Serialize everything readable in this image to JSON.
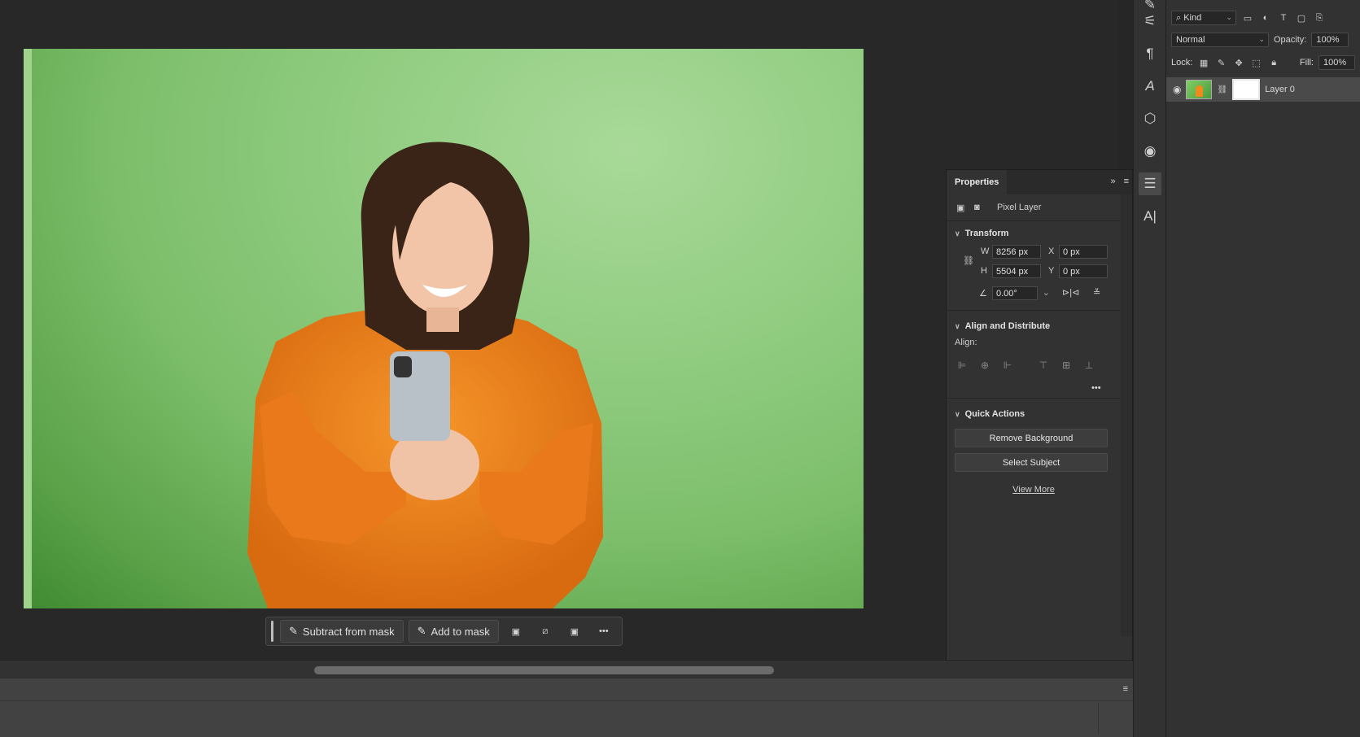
{
  "context_bar": {
    "subtract_label": "Subtract from mask",
    "add_label": "Add to mask",
    "more_label": "•••"
  },
  "layers_panel": {
    "filter_kind": "Kind",
    "blend_mode": "Normal",
    "opacity_label": "Opacity:",
    "opacity_value": "100%",
    "lock_label": "Lock:",
    "fill_label": "Fill:",
    "fill_value": "100%",
    "layer_name": "Layer 0"
  },
  "properties": {
    "tab_label": "Properties",
    "layer_type": "Pixel Layer",
    "transform": {
      "title": "Transform",
      "w_label": "W",
      "w_value": "8256 px",
      "h_label": "H",
      "h_value": "5504 px",
      "x_label": "X",
      "x_value": "0 px",
      "y_label": "Y",
      "y_value": "0 px",
      "angle_value": "0.00°"
    },
    "align": {
      "title": "Align and Distribute",
      "align_label": "Align:",
      "more_label": "•••"
    },
    "quick_actions": {
      "title": "Quick Actions",
      "remove_bg": "Remove Background",
      "select_subject": "Select Subject",
      "view_more": "View More"
    }
  },
  "colors": {
    "app_bg": "#262626",
    "panel_bg": "#323232",
    "accent_bg_green": "#8fcb7f",
    "sweater_orange": "#f08a1c"
  }
}
